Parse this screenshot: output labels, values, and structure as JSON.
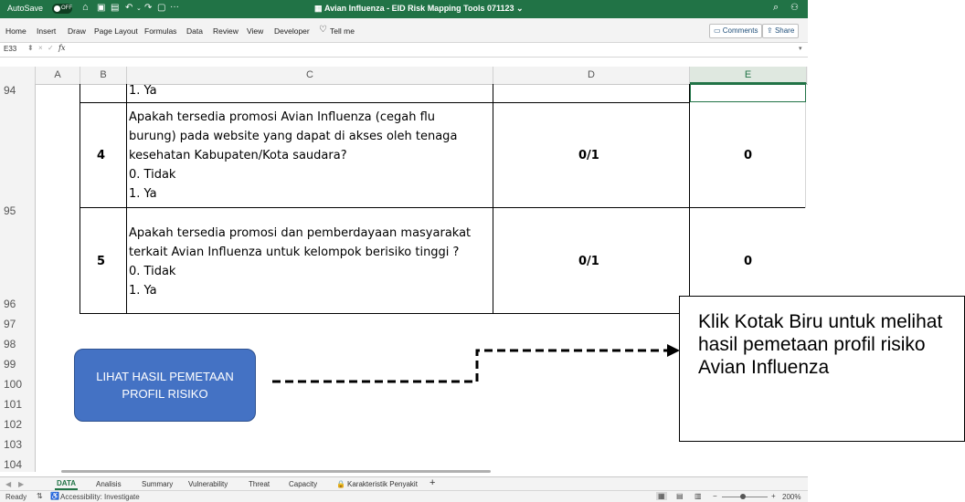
{
  "window": {
    "autosave_label": "AutoSave",
    "autosave_state": "OFF",
    "title": "Avian Influenza - EID Risk Mapping Tools 071123 ⌄"
  },
  "ribbon": {
    "tabs": [
      "Home",
      "Insert",
      "Draw",
      "Page Layout",
      "Formulas",
      "Data",
      "Review",
      "View",
      "Developer",
      "Tell me"
    ],
    "comments_label": "Comments",
    "share_label": "Share"
  },
  "formula_bar": {
    "cell_ref": "E33",
    "fx": "fx"
  },
  "columns": [
    "A",
    "B",
    "C",
    "D",
    "E"
  ],
  "rows": [
    "94",
    "95",
    "96",
    "97",
    "98",
    "99",
    "100",
    "101",
    "102",
    "103",
    "104"
  ],
  "table": {
    "row94_c": "1. Ya",
    "row95": {
      "no": "4",
      "lines": [
        "Apakah tersedia promosi Avian Influenza (cegah flu",
        "burung) pada website yang dapat di akses oleh tenaga",
        "kesehatan Kabupaten/Kota saudara?",
        "0. Tidak",
        "1. Ya"
      ],
      "range": "0/1",
      "value": "0"
    },
    "row96": {
      "no": "5",
      "lines": [
        "Apakah tersedia promosi dan pemberdayaan masyarakat",
        "terkait Avian Influenza untuk kelompok berisiko tinggi ?",
        "0. Tidak",
        "1. Ya"
      ],
      "range": "0/1",
      "value": "0"
    }
  },
  "button": {
    "label": "LIHAT HASIL PEMETAAN PROFIL RISIKO"
  },
  "callout": {
    "text": "Klik Kotak Biru untuk melihat hasil pemetaan profil risiko Avian Influenza"
  },
  "sheet_tabs": [
    "DATA",
    "Analisis",
    "Summary",
    "Vulnerability",
    "Threat",
    "Capacity",
    "Karakteristik Penyakit"
  ],
  "status": {
    "ready": "Ready",
    "accessibility": "Accessibility: Investigate",
    "zoom": "200%"
  },
  "colors": {
    "excel_green": "#217346",
    "button_blue": "#4472c4",
    "selected_col": "#217346"
  }
}
